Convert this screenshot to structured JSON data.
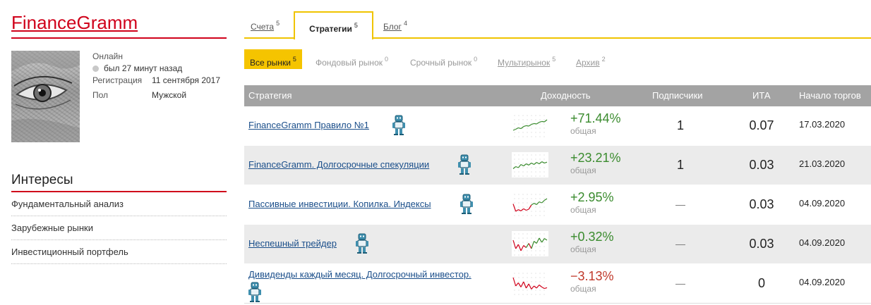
{
  "profile": {
    "name": "FinanceGramm",
    "status_label": "Онлайн",
    "last_seen": "был 27 минут назад",
    "registration_label": "Регистрация",
    "registration_value": "11 сентября 2017",
    "gender_label": "Пол",
    "gender_value": "Мужской"
  },
  "interests": {
    "title": "Интересы",
    "items": [
      {
        "label": "Фундаментальный анализ"
      },
      {
        "label": "Зарубежные рынки"
      },
      {
        "label": "Инвестиционный портфель"
      }
    ]
  },
  "tabs": [
    {
      "label": "Счета",
      "count": "5",
      "active": false
    },
    {
      "label": "Стратегии",
      "count": "5",
      "active": true
    },
    {
      "label": "Блог",
      "count": "4",
      "active": false
    }
  ],
  "markets": [
    {
      "label": "Все рынки",
      "count": "5",
      "state": "active"
    },
    {
      "label": "Фондовый рынок",
      "count": "0",
      "state": "disabled"
    },
    {
      "label": "Срочный рынок",
      "count": "0",
      "state": "disabled"
    },
    {
      "label": "Мультирынок",
      "count": "5",
      "state": "link"
    },
    {
      "label": "Архив",
      "count": "2",
      "state": "link"
    }
  ],
  "table": {
    "headers": {
      "strategy": "Стратегия",
      "return": "Доходность",
      "subscribers": "Подписчики",
      "ita": "ИТА",
      "start": "Начало торгов"
    },
    "rows": [
      {
        "name": "FinanceGramm Правило №1",
        "return": "+71.44%",
        "return_sub": "общая",
        "trend": "pos",
        "subscribers": "1",
        "ita": "0.07",
        "start": "17.03.2020",
        "spark": [
          0.3,
          0.35,
          0.42,
          0.38,
          0.48,
          0.52,
          0.5,
          0.58,
          0.62,
          0.6,
          0.68,
          0.72,
          0.7,
          0.8
        ]
      },
      {
        "name": "FinanceGramm. Долгосрочные спекуляции",
        "return": "+23.21%",
        "return_sub": "общая",
        "trend": "pos",
        "subscribers": "1",
        "ita": "0.03",
        "start": "21.03.2020",
        "spark": [
          0.35,
          0.45,
          0.4,
          0.55,
          0.48,
          0.58,
          0.52,
          0.62,
          0.55,
          0.65,
          0.58,
          0.68,
          0.62,
          0.66
        ]
      },
      {
        "name": "Пассивные инвестиции. Копилка. Индексы",
        "return": "+2.95%",
        "return_sub": "общая",
        "trend": "mixed",
        "subscribers": "—",
        "ita": "0.03",
        "start": "04.09.2020",
        "spark": [
          0.55,
          0.2,
          0.28,
          0.22,
          0.32,
          0.25,
          0.3,
          0.5,
          0.58,
          0.52,
          0.65,
          0.6,
          0.72,
          0.8
        ]
      },
      {
        "name": "Неспешный трейдер",
        "return": "+0.32%",
        "return_sub": "общая",
        "trend": "mixed",
        "subscribers": "—",
        "ita": "0.03",
        "start": "04.09.2020",
        "spark": [
          0.7,
          0.3,
          0.5,
          0.2,
          0.45,
          0.35,
          0.55,
          0.3,
          0.65,
          0.55,
          0.8,
          0.6,
          0.78,
          0.7
        ]
      },
      {
        "name": "Дивиденды каждый месяц. Долгосрочный инвестор.",
        "return": "−3.13%",
        "return_sub": "общая",
        "trend": "neg",
        "subscribers": "—",
        "ita": "0",
        "start": "04.09.2020",
        "spark": [
          0.8,
          0.4,
          0.55,
          0.35,
          0.6,
          0.3,
          0.5,
          0.25,
          0.4,
          0.3,
          0.45,
          0.35,
          0.28,
          0.32
        ]
      }
    ]
  },
  "colors": {
    "brand_red": "#d0021b",
    "accent_yellow": "#f0c400",
    "positive": "#3a8b2e",
    "negative": "#c0392b",
    "link": "#1a4e8a",
    "header_gray": "#a3a3a3"
  }
}
